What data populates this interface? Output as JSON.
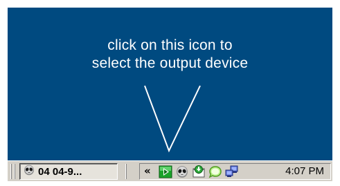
{
  "desktop": {
    "instruction_line1": "click on this icon to",
    "instruction_line2": "select the output device",
    "background_color": "#004a80",
    "text_color": "#ffffff"
  },
  "taskbar": {
    "task_button_label": "04 04-9...",
    "task_button_icon": "alien-head-icon",
    "tray_expand_label": "«",
    "tray_icons": [
      "media-play-icon",
      "alien-head-icon",
      "mail-download-icon",
      "green-chat-icon",
      "network-computers-icon"
    ],
    "clock": "4:07 PM"
  }
}
